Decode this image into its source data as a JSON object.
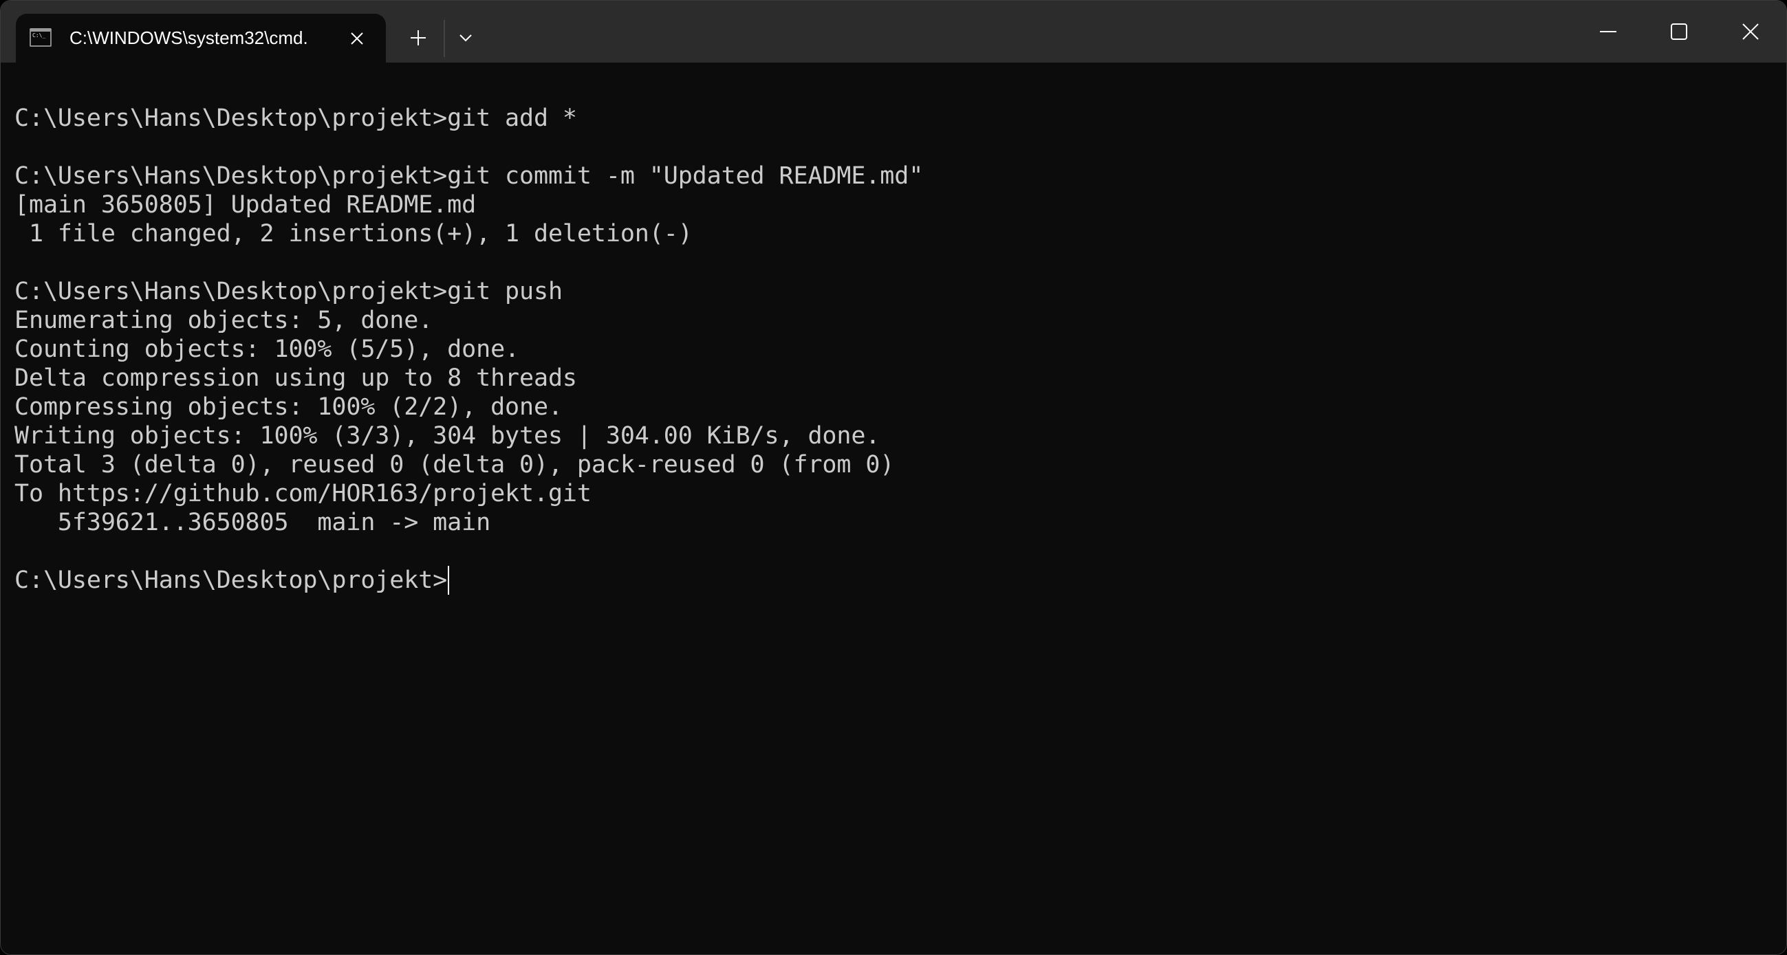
{
  "window": {
    "tab": {
      "icon": "cmd-terminal-icon",
      "title": "C:\\WINDOWS\\system32\\cmd.",
      "close_icon": "close-icon"
    },
    "new_tab_icon": "plus-icon",
    "dropdown_icon": "chevron-down-icon",
    "controls": {
      "minimize": "minimize-icon",
      "maximize": "maximize-icon",
      "close": "close-icon"
    },
    "tab_icon_prompt": "C:\\_"
  },
  "colors": {
    "titlebar_bg": "#2c2c2c",
    "terminal_bg": "#0c0c0c",
    "terminal_fg": "#cccccc",
    "tab_title_fg": "#ffffff"
  },
  "terminal": {
    "lines": [
      "",
      "C:\\Users\\Hans\\Desktop\\projekt>git add *",
      "",
      "C:\\Users\\Hans\\Desktop\\projekt>git commit -m \"Updated README.md\"",
      "[main 3650805] Updated README.md",
      " 1 file changed, 2 insertions(+), 1 deletion(-)",
      "",
      "C:\\Users\\Hans\\Desktop\\projekt>git push",
      "Enumerating objects: 5, done.",
      "Counting objects: 100% (5/5), done.",
      "Delta compression using up to 8 threads",
      "Compressing objects: 100% (2/2), done.",
      "Writing objects: 100% (3/3), 304 bytes | 304.00 KiB/s, done.",
      "Total 3 (delta 0), reused 0 (delta 0), pack-reused 0 (from 0)",
      "To https://github.com/HOR163/projekt.git",
      "   5f39621..3650805  main -> main",
      "",
      "C:\\Users\\Hans\\Desktop\\projekt>"
    ]
  }
}
